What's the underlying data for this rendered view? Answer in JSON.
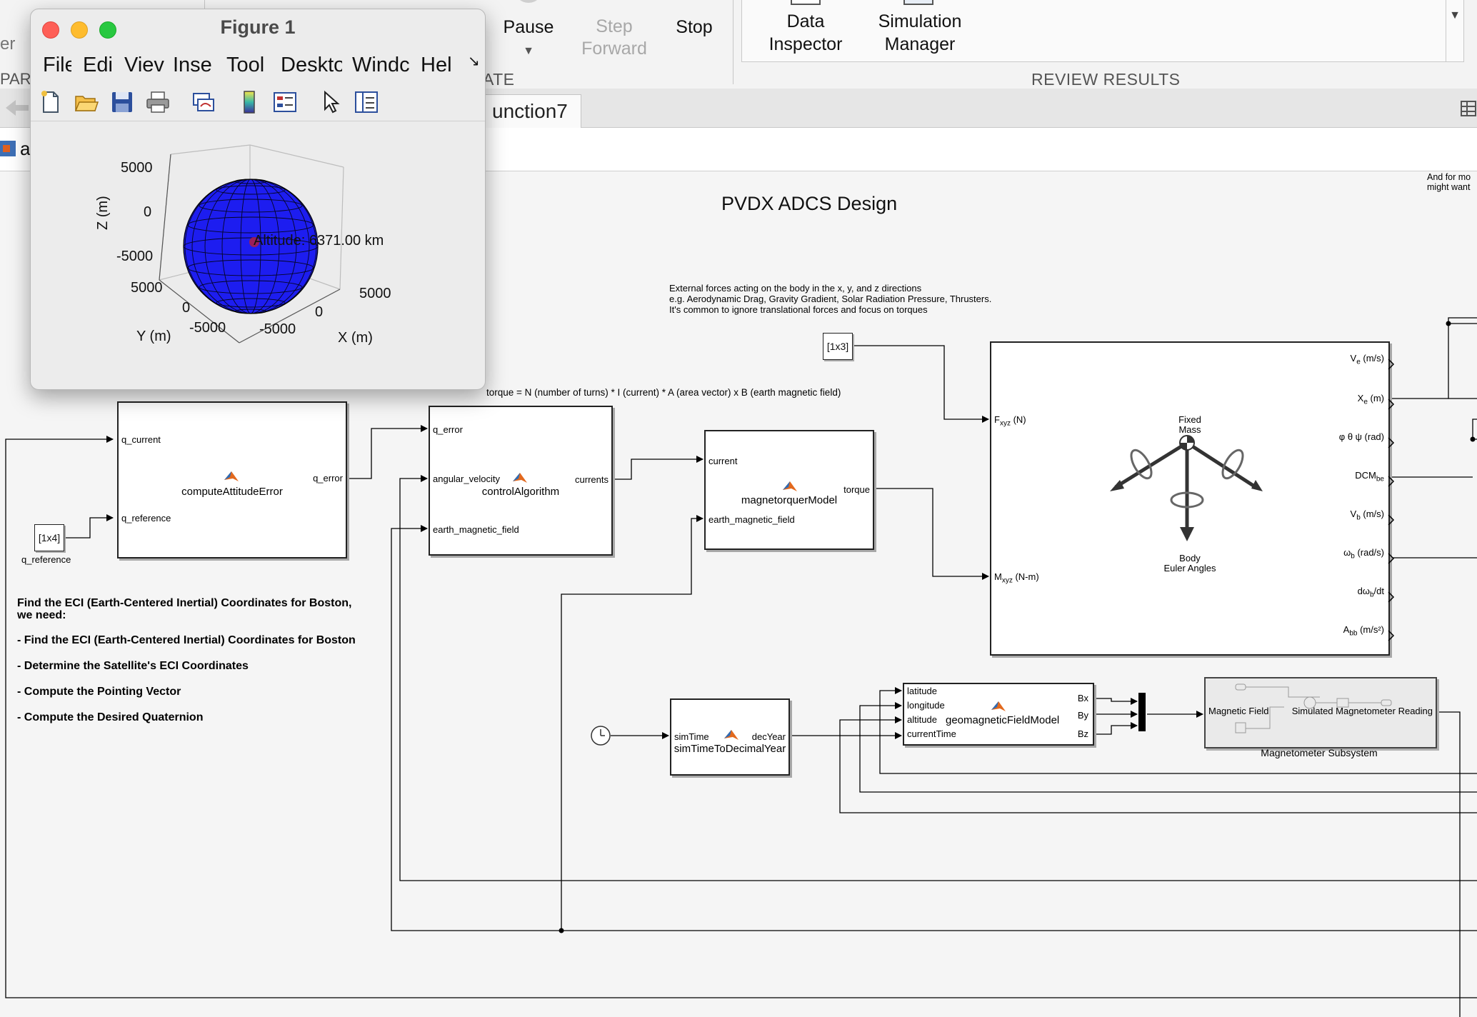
{
  "toolstrip": {
    "left_cut_labels": [
      "er",
      "PAR"
    ],
    "pause_label": "Pause",
    "step_forward_label": "Step\nForward",
    "stop_label": "Stop",
    "data_inspector_label": "Data\nInspector",
    "simulation_manager_label": "Simulation\nManager",
    "section_simulate_cut": "ATE",
    "section_review": "REVIEW RESULTS"
  },
  "tabbar": {
    "tab_label": "unction7"
  },
  "breadcrumb": {
    "first_char": "a"
  },
  "figure": {
    "title": "Figure 1",
    "menus": [
      "File",
      "Edi",
      "Viev",
      "Inse",
      "Tool",
      "Deskto",
      "Windc",
      "Hel"
    ],
    "toolbar_icons": [
      "new-file-icon",
      "open-folder-icon",
      "save-icon",
      "print-icon",
      "link-plot-icon",
      "colorbar-icon",
      "legend-icon",
      "pointer-icon",
      "property-editor-icon"
    ],
    "axes": {
      "zlabel": "Z (m)",
      "ylabel": "Y (m)",
      "xlabel": "X (m)",
      "z_ticks": [
        "5000",
        "0",
        "-5000"
      ],
      "y_ticks": [
        "5000",
        "0",
        "-5000"
      ],
      "x_ticks": [
        "-5000",
        "0",
        "5000"
      ],
      "annotation": "Altitude: 6371.00 km",
      "sphere_color": "#1d1df0",
      "marker_color": "#b02040"
    }
  },
  "diagram": {
    "title": "PVDX ADCS Design",
    "corner_note": [
      "And for mo",
      "might want"
    ],
    "external_forces_note": [
      "External forces acting on the body in the x, y, and z directions",
      "e.g. Aerodynamic Drag, Gravity Gradient, Solar Radiation Pressure, Thrusters.",
      "It's common to ignore translational forces and focus on torques"
    ],
    "torque_note": "torque = N (number of turns) * I  (current) * A (area vector) x B (earth magnetic field)",
    "const_1x3": "[1x3]",
    "const_1x4": "[1x4]",
    "q_reference_label": "q_reference",
    "blocks": {
      "compute_error": {
        "name": "computeAttitudeError",
        "in1": "q_current",
        "in2": "q_reference",
        "out": "q_error"
      },
      "control": {
        "name": "controlAlgorithm",
        "in1": "q_error",
        "in2": "angular_velocity",
        "in3": "earth_magnetic_field",
        "out": "currents"
      },
      "magnetorquer": {
        "name": "magnetorquerModel",
        "in1": "current",
        "in2": "earth_magnetic_field",
        "out": "torque"
      },
      "sixdof": {
        "in1": "F",
        "in1_sub": "xyz",
        "in1_unit": " (N)",
        "in2": "M",
        "in2_sub": "xyz",
        "in2_unit": " (N-m)",
        "center_top": [
          "Fixed",
          "Mass"
        ],
        "center_bottom": [
          "Body",
          "Euler Angles"
        ],
        "outputs": [
          {
            "main": "V",
            "sub": "e",
            "unit": " (m/s)"
          },
          {
            "main": "X",
            "sub": "e",
            "unit": " (m)"
          },
          {
            "main": "φ θ ψ (rad)",
            "sub": "",
            "unit": ""
          },
          {
            "main": "DCM",
            "sub": "be",
            "unit": ""
          },
          {
            "main": "V",
            "sub": "b",
            "unit": " (m/s)"
          },
          {
            "main": "ω",
            "sub": "b",
            "unit": " (rad/s)"
          },
          {
            "main": "dω",
            "sub": "b",
            "unit": "/dt"
          },
          {
            "main": "A",
            "sub": "bb",
            "unit": " (m/s²)"
          }
        ]
      },
      "sim_time": {
        "name": "simTimeToDecimalYear",
        "in": "simTime",
        "out": "decYear"
      },
      "geomag": {
        "name": "geomagneticFieldModel",
        "in1": "latitude",
        "in2": "longitude",
        "in3": "altitude",
        "in4": "currentTime",
        "out1": "Bx",
        "out2": "By",
        "out3": "Bz"
      },
      "magnetometer": {
        "name": "Magnetometer Subsystem",
        "in": "Magnetic Field",
        "out": "Simulated Magnetometer Reading"
      }
    },
    "instructions": [
      "Find the ECI (Earth-Centered Inertial) Coordinates for Boston,",
      "we need:",
      "- Find the ECI (Earth-Centered Inertial) Coordinates for Boston",
      "- Determine the Satellite's ECI Coordinates",
      "- Compute the Pointing Vector",
      "- Compute the Desired Quaternion"
    ]
  }
}
